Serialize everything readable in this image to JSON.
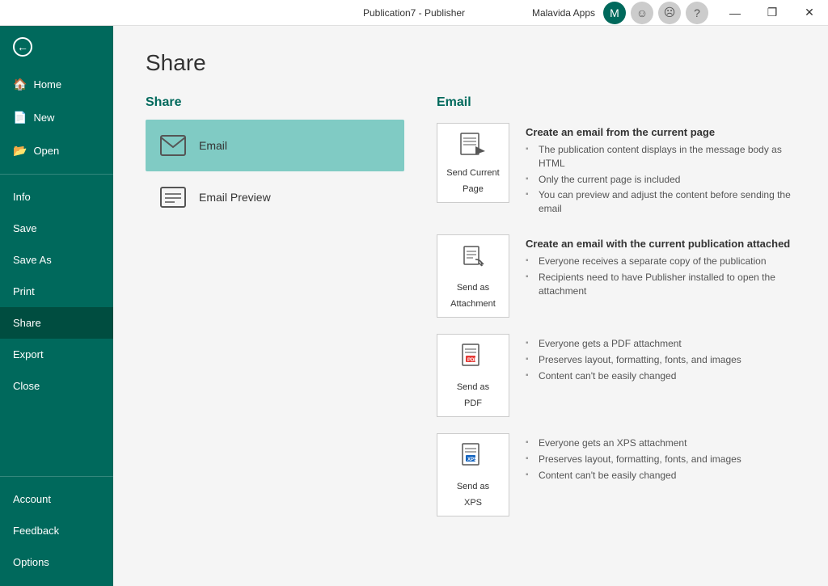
{
  "titlebar": {
    "title": "Publication7 - Publisher",
    "malavida": "Malavida Apps",
    "minimize": "—",
    "restore": "❐",
    "close": "✕",
    "emoji1": "☺",
    "emoji2": "☹",
    "help": "?"
  },
  "sidebar": {
    "back_label": "",
    "items": [
      {
        "id": "home",
        "label": "Home",
        "icon": "🏠"
      },
      {
        "id": "new",
        "label": "New",
        "icon": "📄"
      },
      {
        "id": "open",
        "label": "Open",
        "icon": "📂"
      }
    ],
    "secondary": [
      {
        "id": "info",
        "label": "Info"
      },
      {
        "id": "save",
        "label": "Save"
      },
      {
        "id": "save-as",
        "label": "Save As"
      },
      {
        "id": "print",
        "label": "Print"
      },
      {
        "id": "share",
        "label": "Share",
        "active": true
      },
      {
        "id": "export",
        "label": "Export"
      },
      {
        "id": "close",
        "label": "Close"
      }
    ],
    "bottom": [
      {
        "id": "account",
        "label": "Account"
      },
      {
        "id": "feedback",
        "label": "Feedback"
      },
      {
        "id": "options",
        "label": "Options"
      }
    ]
  },
  "page": {
    "title": "Share",
    "share_section": "Share",
    "email_section": "Email"
  },
  "share_options": [
    {
      "id": "email",
      "label": "Email",
      "active": true
    },
    {
      "id": "email-preview",
      "label": "Email Preview"
    }
  ],
  "email_options": [
    {
      "id": "send-current-page",
      "label": "Send Current\nPage",
      "label_line1": "Send Current",
      "label_line2": "Page",
      "title": "Create an email from the current page",
      "bullets": [
        "The publication content displays in the message body as HTML",
        "Only the current page is included",
        "You can preview and adjust the content before sending the email"
      ]
    },
    {
      "id": "send-as-attachment",
      "label_line1": "Send as",
      "label_line2": "Attachment",
      "title": "Create an email with the current publication attached",
      "bullets": [
        "Everyone receives a separate copy of the publication",
        "Recipients need to have Publisher installed to open the attachment"
      ]
    },
    {
      "id": "send-as-pdf",
      "label_line1": "Send as",
      "label_line2": "PDF",
      "title": "",
      "bullets": [
        "Everyone gets a PDF attachment",
        "Preserves layout, formatting, fonts, and images",
        "Content can't be easily changed"
      ]
    },
    {
      "id": "send-as-xps",
      "label_line1": "Send as",
      "label_line2": "XPS",
      "title": "",
      "bullets": [
        "Everyone gets an XPS attachment",
        "Preserves layout, formatting, fonts, and images",
        "Content can't be easily changed"
      ]
    }
  ]
}
